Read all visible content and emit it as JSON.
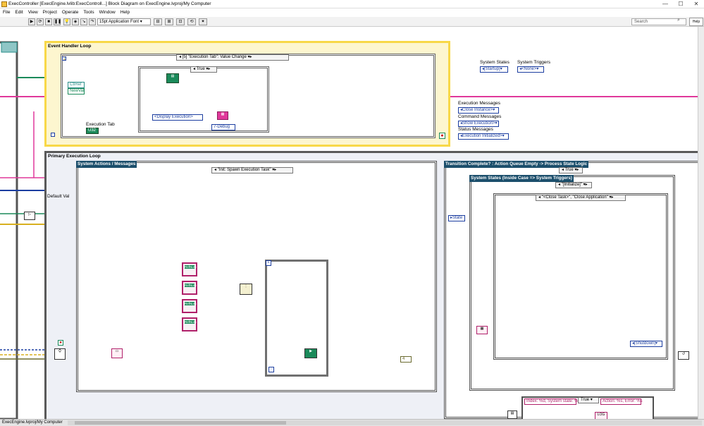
{
  "window": {
    "title": "ExecController [ExecEngine.lvlib:ExecControll...] Block Diagram on ExecEngine.lvproj/My Computer",
    "minimize": "—",
    "maximize": "☐",
    "close": "✕"
  },
  "menu": [
    "File",
    "Edit",
    "View",
    "Project",
    "Operate",
    "Tools",
    "Window",
    "Help"
  ],
  "toolbar": {
    "font": "15pt Application Font",
    "search_placeholder": "Search",
    "help_label": "Help"
  },
  "diagram": {
    "event_loop_title": "Event Handler Loop",
    "event_case": "[5] \"Execution Tab\": Value Change",
    "inner_case_true": "True",
    "ctlref": "CtlRef",
    "newval": "NewVal",
    "execution_tab": "Execution Tab",
    "execution_tab_terminal": "U32",
    "display_execution": "<Display Execution>",
    "debug_enum": "7-Debug",
    "loop_index": "i",
    "system_states_label": "System States",
    "system_states_value": "[Startup]",
    "system_triggers_label": "System Triggers",
    "system_triggers_value": "<None>",
    "execution_messages_label": "Execution Messages",
    "execution_messages_value": "Close Instance>",
    "command_messages_label": "Command Messages",
    "command_messages_value": "Show Execution>",
    "status_messages_label": "Status Messages",
    "status_messages_value": "Execution Initialized>",
    "primary_loop_title": "Primary Execution Loop",
    "system_actions_title": "System Actions / Messages",
    "spawn_case": "\"Init: Spawn Execution Task\"",
    "default_val": "Default Val",
    "transition_title": "Transition Complete? : Action Queue Empty -> Process State Logic",
    "transition_case": "True",
    "system_states_inside_title": "System States  (Inside Case => System Triggers)",
    "initialize_case": "\"[Initialize]\"",
    "close_task_case": "\"<Close Task>\", \"Close Application\"",
    "state_label": "State",
    "shutdown_value": "[Shutdown]",
    "format_string": "Index: %d, System state: %",
    "format_case": "True",
    "format_string2": "Action: %s, Error: %s",
    "refnum_labels": [
      "RefNum",
      "RefNum",
      "RefNum",
      "RefNum"
    ],
    "for_loop_n": "N",
    "wire_value": "4",
    "vi_icon_text": "LOG"
  },
  "status": {
    "path": "ExecEngine.lvproj/My Computer"
  },
  "colors": {
    "pink": "#e0389a",
    "blue": "#1c3ea0",
    "green": "#1b8a5a",
    "teal": "#2a8f8a",
    "yellow_loop": "#f8d848",
    "yellow_bg": "#fdf6cf",
    "case_header": "#1c4f6c"
  }
}
